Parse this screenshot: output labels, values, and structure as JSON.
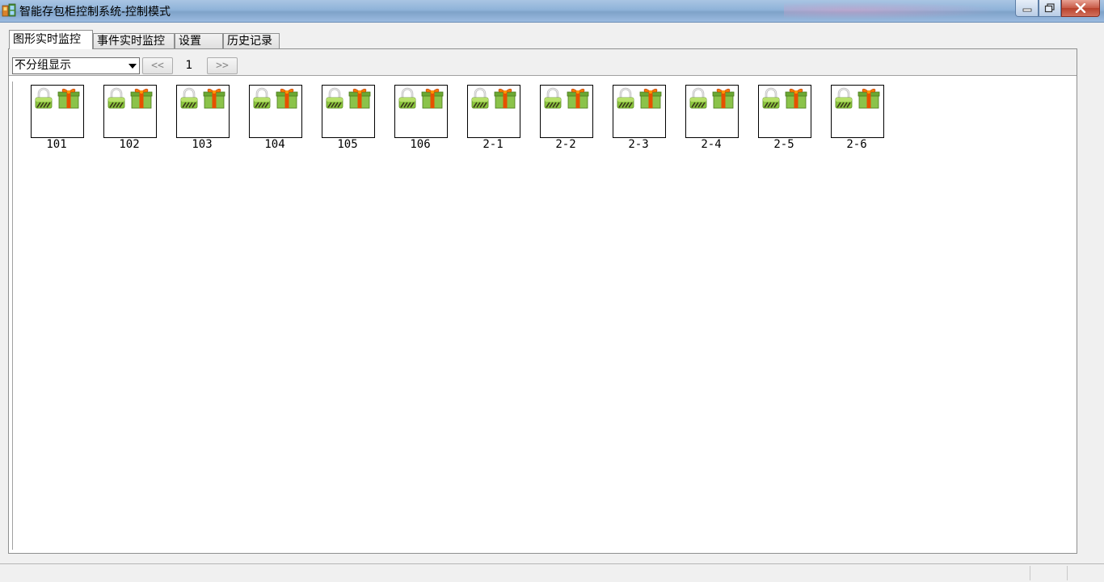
{
  "window": {
    "title": "智能存包柜控制系统-控制模式",
    "icon": "app-cabinet-icon",
    "buttons": {
      "minimize": "minimize-icon",
      "maximize": "maximize-icon",
      "close": "close-icon"
    }
  },
  "tabs": [
    {
      "label": "图形实时监控",
      "active": true
    },
    {
      "label": "事件实时监控",
      "active": false
    },
    {
      "label": "设置",
      "active": false
    },
    {
      "label": "历史记录",
      "active": false
    }
  ],
  "toolbar": {
    "group_select_value": "不分组显示",
    "prev_label": "<<",
    "page_number": "1",
    "next_label": ">>"
  },
  "lockers": [
    {
      "label": "101"
    },
    {
      "label": "102"
    },
    {
      "label": "103"
    },
    {
      "label": "104"
    },
    {
      "label": "105"
    },
    {
      "label": "106"
    },
    {
      "label": "2-1"
    },
    {
      "label": "2-2"
    },
    {
      "label": "2-3"
    },
    {
      "label": "2-4"
    },
    {
      "label": "2-5"
    },
    {
      "label": "2-6"
    }
  ],
  "locker_icons": {
    "status": "padlock-icon",
    "contents": "gift-box-icon"
  },
  "colors": {
    "lock_green": "#7cb342",
    "gift_green": "#8bc34a",
    "gift_ribbon": "#e65100",
    "close_red": "#c75a47"
  }
}
